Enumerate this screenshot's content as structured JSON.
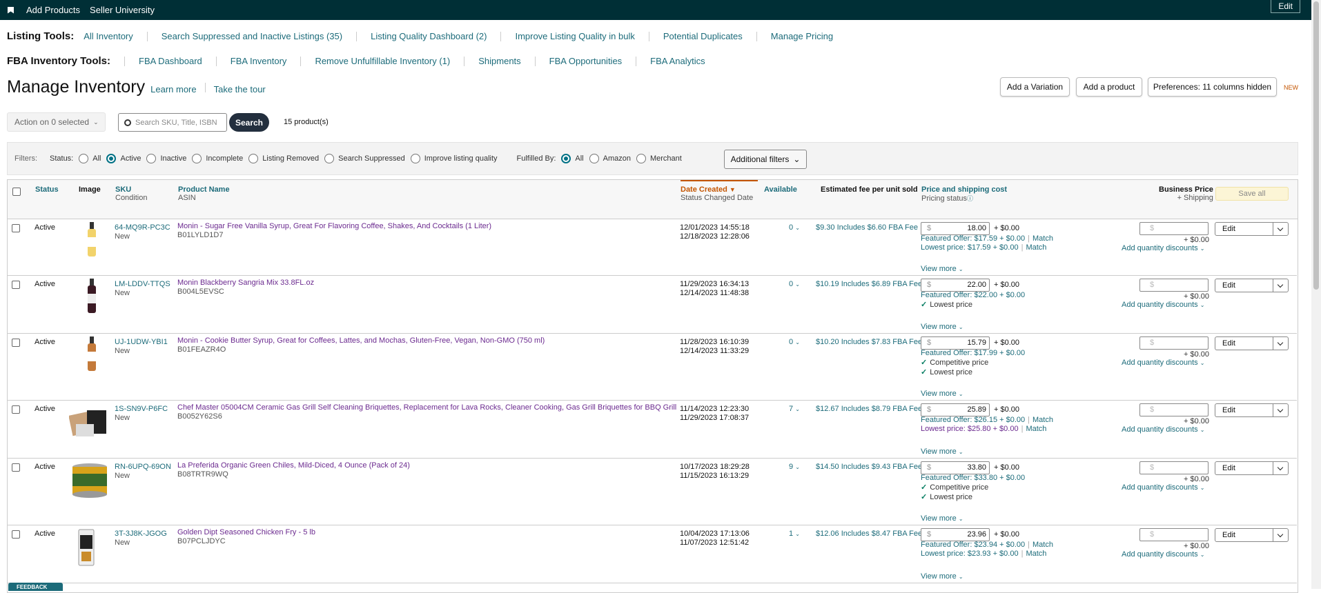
{
  "topbar": {
    "items": [
      "Add Products",
      "Seller University"
    ],
    "edit": "Edit"
  },
  "listing_tools": {
    "label": "Listing Tools:",
    "items": [
      "All Inventory",
      "Search Suppressed and Inactive Listings (35)",
      "Listing Quality Dashboard (2)",
      "Improve Listing Quality in bulk",
      "Potential Duplicates",
      "Manage Pricing"
    ]
  },
  "fba_tools": {
    "label": "FBA Inventory Tools:",
    "items": [
      "FBA Dashboard",
      "FBA Inventory",
      "Remove Unfulfillable Inventory (1)",
      "Shipments",
      "FBA Opportunities",
      "FBA Analytics"
    ]
  },
  "page": {
    "title": "Manage Inventory",
    "learn": "Learn more",
    "tour": "Take the tour"
  },
  "buttons": {
    "variation": "Add a Variation",
    "product": "Add a product",
    "prefs": "Preferences: 11 columns hidden",
    "new": "NEW"
  },
  "toolbar": {
    "action": "Action on 0 selected",
    "search_placeholder": "Search SKU, Title, ISBN",
    "search": "Search",
    "count": "15 product(s)"
  },
  "filters": {
    "label": "Filters:",
    "status_label": "Status:",
    "status": [
      "All",
      "Active",
      "Inactive",
      "Incomplete",
      "Listing Removed",
      "Search Suppressed",
      "Improve listing quality"
    ],
    "fulfilled_label": "Fulfilled By:",
    "fulfilled": [
      "All",
      "Amazon",
      "Merchant"
    ],
    "additional": "Additional filters"
  },
  "headers": {
    "status": "Status",
    "image": "Image",
    "sku": "SKU",
    "condition": "Condition",
    "name": "Product Name",
    "asin": "ASIN",
    "date": "Date Created",
    "status_changed": "Status Changed Date",
    "available": "Available",
    "fee": "Estimated fee per unit sold",
    "price": "Price and shipping cost",
    "pricing_status": "Pricing status",
    "business": "Business Price",
    "shipping": "+ Shipping",
    "save": "Save all"
  },
  "common": {
    "active": "Active",
    "new": "New",
    "ship": "+ $0.00",
    "view_more": "View more",
    "add_qty": "Add quantity discounts",
    "edit": "Edit",
    "match": "Match",
    "dollar": "$",
    "lowest": "Lowest price",
    "competitive": "Competitive price"
  },
  "rows": [
    {
      "sku": "64-MQ9R-PC3C",
      "name": "Monin - Sugar Free Vanilla Syrup, Great For Flavoring Coffee, Shakes, And Cocktails (1 Liter)",
      "asin": "B01LYLD1D7",
      "created": "12/01/2023 14:55:18",
      "changed": "12/18/2023 12:28:06",
      "available": "0",
      "fee": "$9.30 Includes $6.60 FBA Fee",
      "price": "18.00",
      "featured": "Featured Offer: $17.59 + $0.00",
      "lowest": "Lowest price: $17.59 + $0.00"
    },
    {
      "sku": "LM-LDDV-TTQS",
      "name": "Monin Blackberry Sangria Mix 33.8FL.oz",
      "asin": "B004L5EVSC",
      "created": "11/29/2023 16:34:13",
      "changed": "12/14/2023 11:48:38",
      "available": "0",
      "fee": "$10.19 Includes $6.89 FBA Fee",
      "price": "22.00",
      "featured": "Featured Offer: $22.00 + $0.00"
    },
    {
      "sku": "UJ-1UDW-YBI1",
      "name": "Monin - Cookie Butter Syrup, Great for Coffees, Lattes, and Mochas, Gluten-Free, Vegan, Non-GMO (750 ml)",
      "asin": "B01FEAZR4O",
      "created": "11/28/2023 16:10:39",
      "changed": "12/14/2023 11:33:29",
      "available": "0",
      "fee": "$10.20 Includes $7.83 FBA Fee",
      "price": "15.79",
      "featured": "Featured Offer: $17.99 + $0.00"
    },
    {
      "sku": "1S-SN9V-P6FC",
      "name": "Chef Master 05004CM Ceramic Gas Grill Self Cleaning Briquettes, Replacement for Lava Rocks, Cleaner Cooking, Gas Grill Briquettes for BBQ Grill",
      "asin": "B0052Y62S6",
      "created": "11/14/2023 12:23:30",
      "changed": "11/29/2023 17:08:37",
      "available": "7",
      "fee": "$12.67 Includes $8.79 FBA Fee",
      "price": "25.89",
      "featured": "Featured Offer: $26.15 + $0.00",
      "lowest": "Lowest price: $25.80 + $0.00"
    },
    {
      "sku": "RN-6UPQ-69ON",
      "name": "La Preferida Organic Green Chiles, Mild-Diced, 4 Ounce (Pack of 24)",
      "asin": "B08TRTR9WQ",
      "created": "10/17/2023 18:29:28",
      "changed": "11/15/2023 16:13:29",
      "available": "9",
      "fee": "$14.50 Includes $9.43 FBA Fee",
      "price": "33.80",
      "featured": "Featured Offer: $33.80 + $0.00"
    },
    {
      "sku": "3T-3J8K-JGOG",
      "name": "Golden Dipt Seasoned Chicken Fry - 5 lb",
      "asin": "B07PCLJDYC",
      "created": "10/04/2023 17:13:06",
      "changed": "11/07/2023 12:51:42",
      "available": "1",
      "fee": "$12.06 Includes $8.47 FBA Fee",
      "price": "23.96",
      "featured": "Featured Offer: $23.94 + $0.00",
      "lowest": "Lowest price: $23.93 + $0.00"
    }
  ],
  "feedback": "FEEDBACK"
}
